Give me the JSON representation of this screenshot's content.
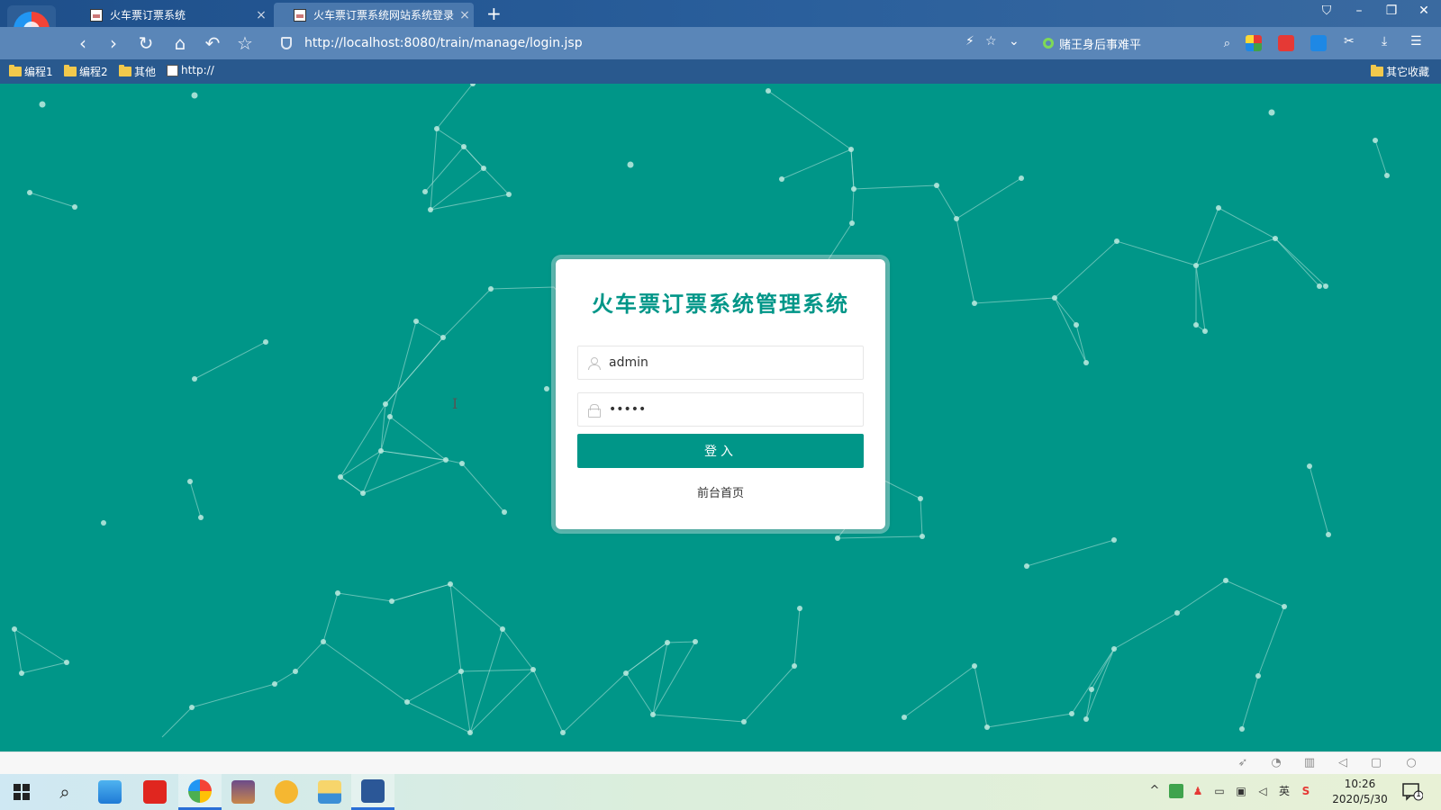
{
  "browser": {
    "tabs": [
      {
        "title": "火车票订票系统",
        "active": false
      },
      {
        "title": "火车票订票系统网站系统登录",
        "active": true
      }
    ],
    "new_tab": "+",
    "window_controls": {
      "skin": "⛉",
      "minimize": "–",
      "restore": "❐",
      "close": "✕"
    },
    "nav": {
      "back": "‹",
      "forward": "›",
      "refresh": "↻",
      "home": "⌂",
      "undo": "↶",
      "favorite": "☆"
    },
    "address": "http://localhost:8080/train/manage/login.jsp",
    "address_actions": {
      "flash": "⚡",
      "star": "☆",
      "dropdown": "⌄"
    },
    "search_text": "赌王身后事难平",
    "search_icon": "⌕",
    "toolbar_right": {
      "cut": "✂",
      "download": "⤓",
      "menu": "☰"
    },
    "bookmarks": [
      "编程1",
      "编程2",
      "其他",
      "http://"
    ],
    "other_bookmarks": "其它收藏"
  },
  "login": {
    "title": "火车票订票系统管理系统",
    "username_value": "admin",
    "password_value": "•••••",
    "submit_label": "登入",
    "home_link": "前台首页",
    "accent": "#009688"
  },
  "statusbar_icons": [
    "rocket-icon",
    "speed-icon",
    "trash-icon",
    "volume-icon",
    "window-icon",
    "zoom-icon"
  ],
  "taskbar": {
    "search_icon": "⌕",
    "tray": {
      "up": "^",
      "ime": "英"
    },
    "time": "10:26",
    "date": "2020/5/30",
    "notification_count": "1"
  }
}
